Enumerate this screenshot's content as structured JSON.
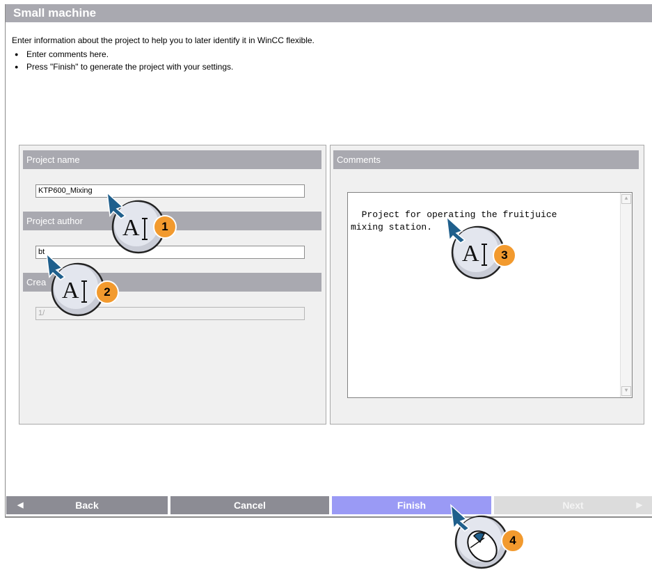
{
  "window": {
    "title": "Small machine"
  },
  "intro": {
    "text": "Enter information about the project to help you to later identify it in WinCC flexible.",
    "bullets": [
      "Enter comments here.",
      "Press \"Finish\" to generate the project with your settings."
    ]
  },
  "left_panel": {
    "project_name": {
      "label": "Project name",
      "value": "KTP600_Mixing"
    },
    "project_author": {
      "label": "Project author",
      "value": "bt"
    },
    "created": {
      "label": "Crea",
      "value": "1/"
    }
  },
  "right_panel": {
    "comments": {
      "label": "Comments",
      "value": "Project for operating the fruitjuice\nmixing station."
    }
  },
  "buttons": {
    "back": "Back",
    "cancel": "Cancel",
    "finish": "Finish",
    "next": "Next"
  },
  "callouts": [
    {
      "number": "1",
      "icon": "text-cursor-icon"
    },
    {
      "number": "2",
      "icon": "text-cursor-icon"
    },
    {
      "number": "3",
      "icon": "text-cursor-icon"
    },
    {
      "number": "4",
      "icon": "mouse-click-icon"
    }
  ],
  "colors": {
    "header": "#a9a9b0",
    "finish": "#9a9af5",
    "badge": "#f29a2e",
    "pointer": "#1f5f8c"
  }
}
